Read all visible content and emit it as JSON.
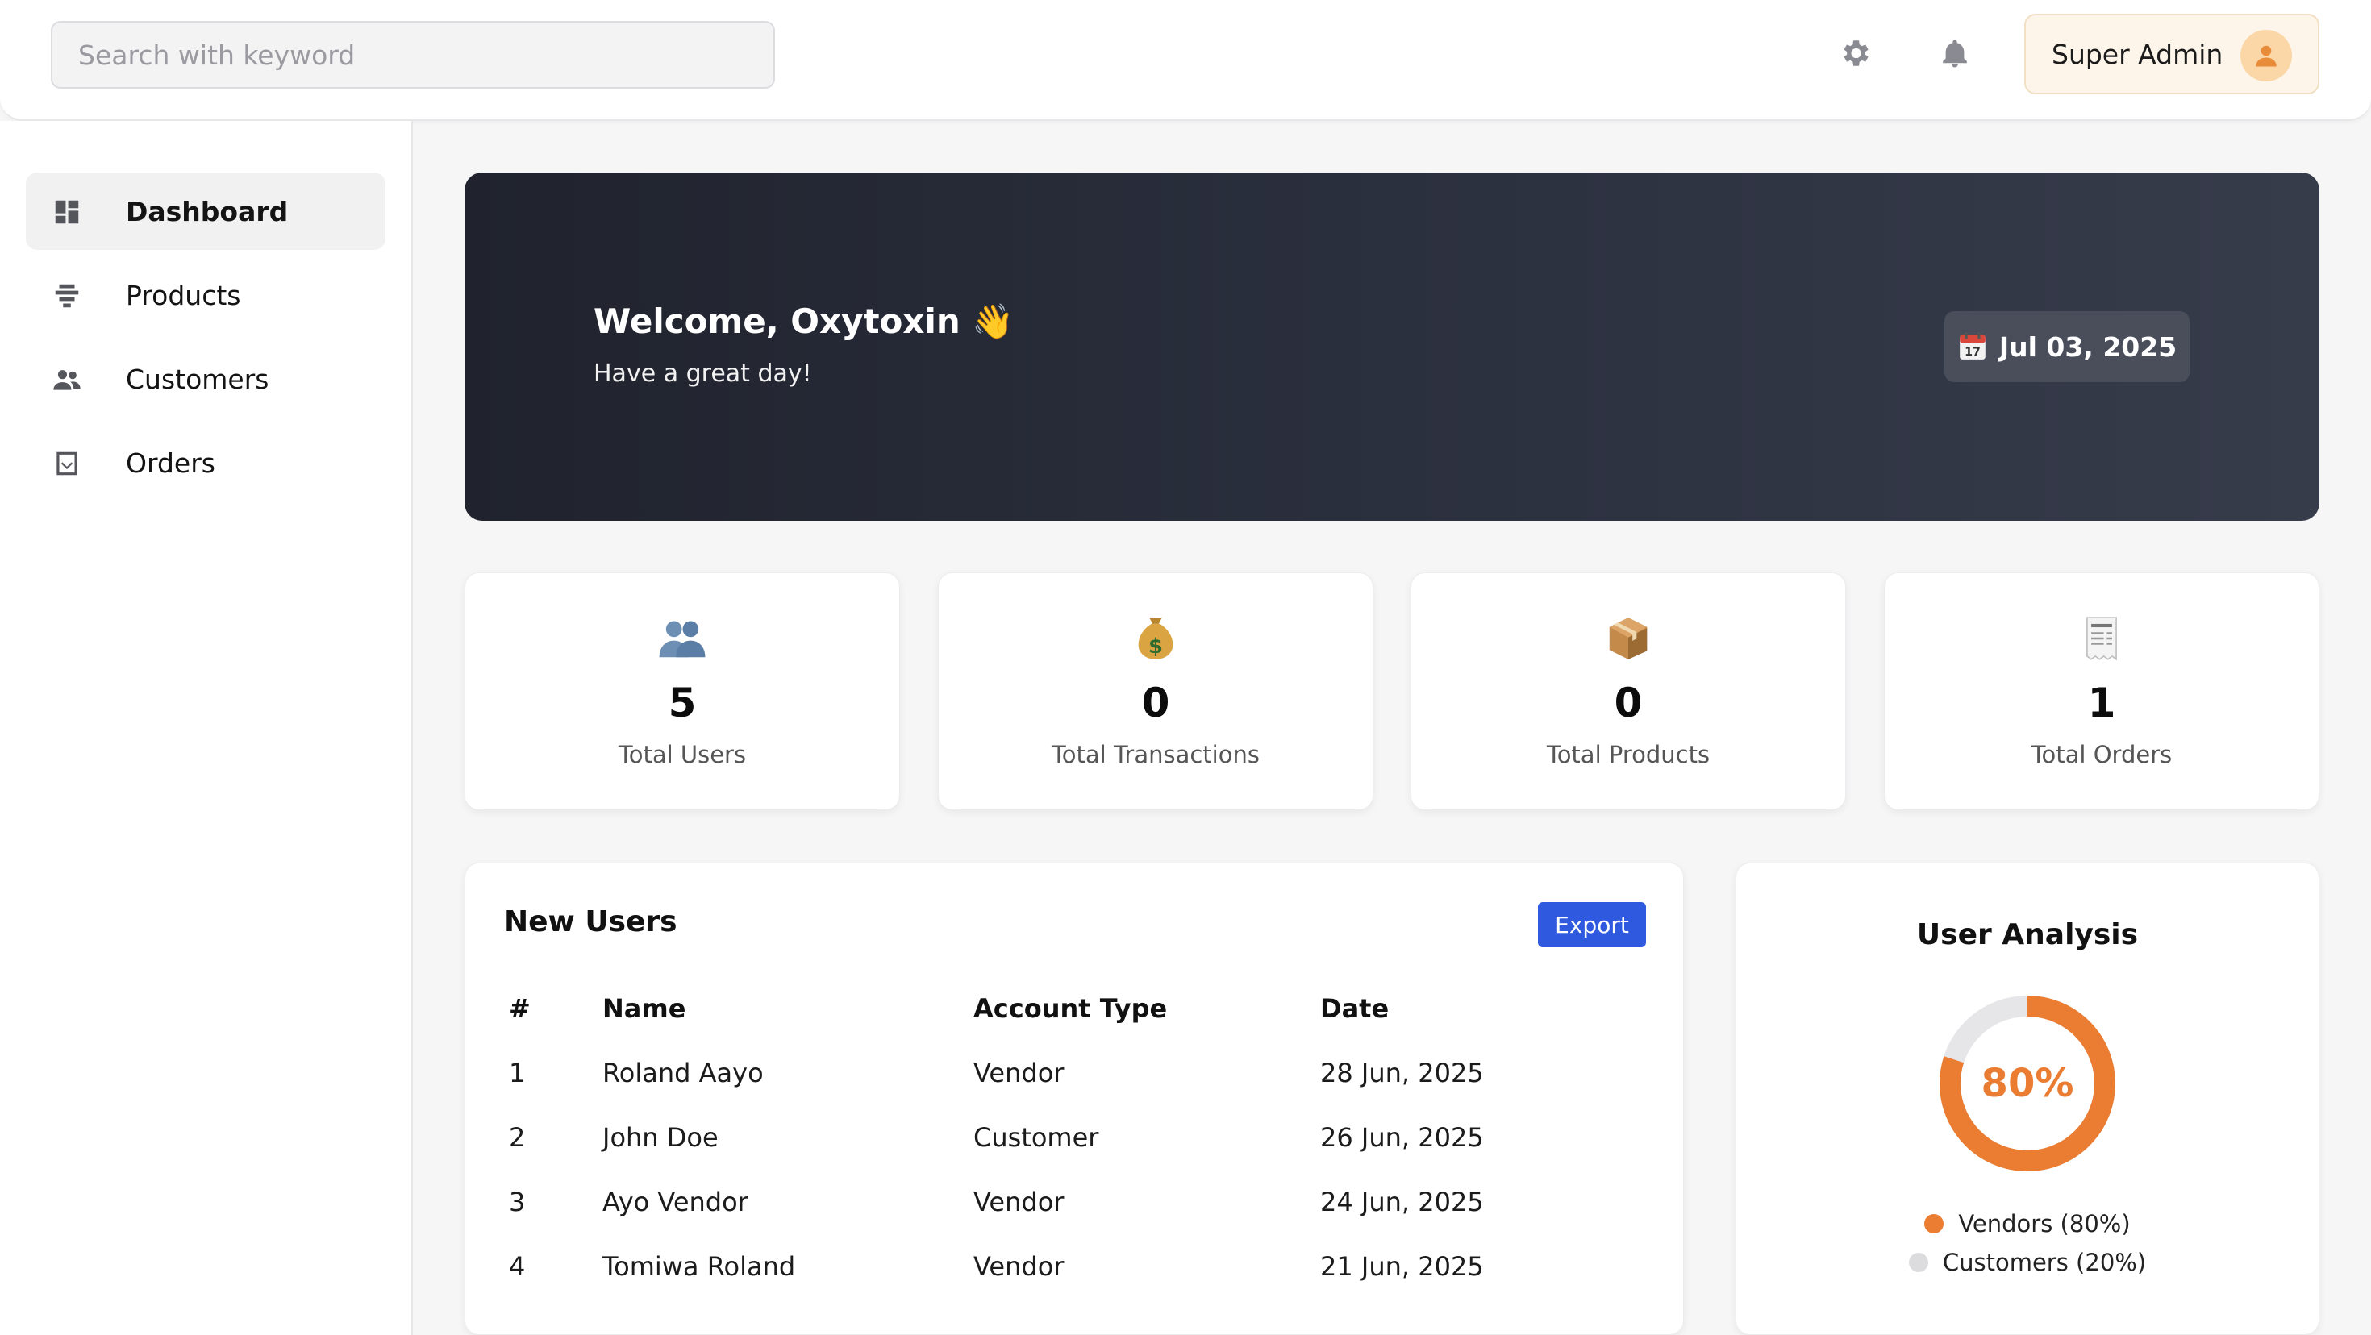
{
  "header": {
    "search_placeholder": "Search with keyword",
    "user_name": "Super Admin"
  },
  "sidebar": {
    "items": [
      {
        "label": "Dashboard",
        "icon": "dashboard-icon",
        "active": true
      },
      {
        "label": "Products",
        "icon": "products-icon",
        "active": false
      },
      {
        "label": "Customers",
        "icon": "customers-icon",
        "active": false
      },
      {
        "label": "Orders",
        "icon": "orders-icon",
        "active": false
      }
    ]
  },
  "banner": {
    "welcome": "Welcome, Oxytoxin 👋",
    "tagline": "Have a great day!",
    "date": "Jul 03, 2025"
  },
  "stats": [
    {
      "icon": "users-icon",
      "value": "5",
      "label": "Total Users"
    },
    {
      "icon": "money-bag-icon",
      "value": "0",
      "label": "Total Transactions"
    },
    {
      "icon": "package-icon",
      "value": "0",
      "label": "Total Products"
    },
    {
      "icon": "receipt-icon",
      "value": "1",
      "label": "Total Orders"
    }
  ],
  "new_users": {
    "title": "New Users",
    "export_label": "Export",
    "columns": [
      "#",
      "Name",
      "Account Type",
      "Date"
    ],
    "rows": [
      [
        "1",
        "Roland Aayo",
        "Vendor",
        "28 Jun, 2025"
      ],
      [
        "2",
        "John Doe",
        "Customer",
        "26 Jun, 2025"
      ],
      [
        "3",
        "Ayo Vendor",
        "Vendor",
        "24 Jun, 2025"
      ],
      [
        "4",
        "Tomiwa Roland",
        "Vendor",
        "21 Jun, 2025"
      ]
    ]
  },
  "analysis": {
    "title": "User Analysis",
    "center_label": "80%",
    "vendors_fraction": 0.8,
    "legend": [
      {
        "label": "Vendors (80%)",
        "color": "#ea7d32"
      },
      {
        "label": "Customers (20%)",
        "color": "#dcdcdf"
      }
    ]
  },
  "colors": {
    "accent": "#2f5ae0",
    "vendor": "#ea7d32",
    "customer": "#e6e6e9"
  }
}
